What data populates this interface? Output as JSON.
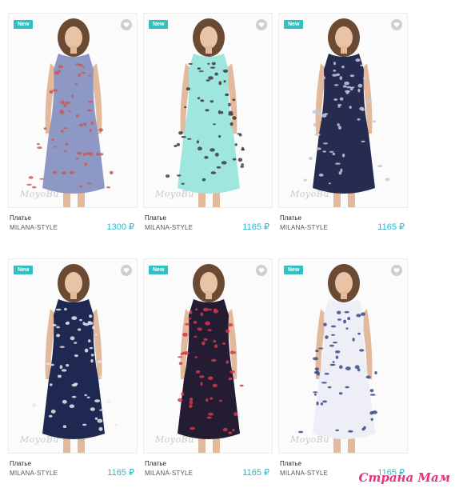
{
  "products": [
    {
      "badge": "New",
      "title": "Платье",
      "brand": "MILANA-STYLE",
      "price": "1300 ₽",
      "watermark": "MoyoBu",
      "dress_color": "#8d99c4",
      "pattern_color": "#c9585a"
    },
    {
      "badge": "New",
      "title": "Платье",
      "brand": "MILANA-STYLE",
      "price": "1165 ₽",
      "watermark": "MoyoBu",
      "dress_color": "#9ee6de",
      "pattern_color": "#3b3b3b"
    },
    {
      "badge": "New",
      "title": "Платье",
      "brand": "MILANA-STYLE",
      "price": "1165 ₽",
      "watermark": "MoyoBu",
      "dress_color": "#252c4f",
      "pattern_color": "#c4c8e0"
    },
    {
      "badge": "New",
      "title": "Платье",
      "brand": "MILANA-STYLE",
      "price": "1165 ₽",
      "watermark": "MoyoBu",
      "dress_color": "#1f2850",
      "pattern_color": "#e6e6f0"
    },
    {
      "badge": "New",
      "title": "Платье",
      "brand": "MILANA-STYLE",
      "price": "1165 ₽",
      "watermark": "MoyoBu",
      "dress_color": "#241c33",
      "pattern_color": "#d23a4c"
    },
    {
      "badge": "New",
      "title": "Платье",
      "brand": "MILANA-STYLE",
      "price": "1165 ₽",
      "watermark": "MoyoBu",
      "dress_color": "#eeeef6",
      "pattern_color": "#3b4a8a"
    }
  ],
  "site_logo": "Страна Мам",
  "colors": {
    "accent": "#2fc1c1",
    "price": "#2ab7c8",
    "logo": "#e2357c"
  }
}
